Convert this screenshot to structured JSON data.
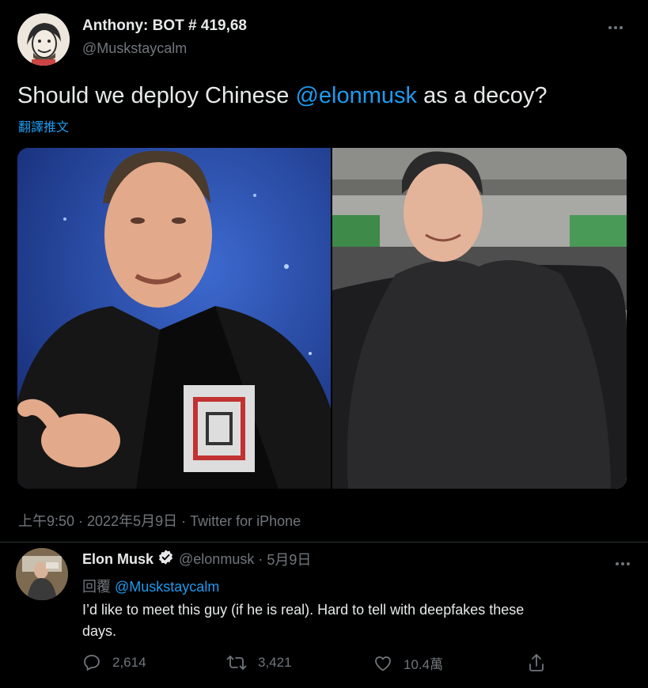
{
  "main_tweet": {
    "author_name": "Anthony: BOT # 419,68",
    "author_handle": "@Muskstaycalm",
    "more_icon": "more-horizontal-icon",
    "text_before": "Should we deploy Chinese ",
    "mention": "@elonmusk",
    "text_after": " as a decoy?",
    "translate_label": "翻譯推文",
    "images": [
      "elon-musk-photo",
      "chinese-elon-lookalike-photo"
    ],
    "timestamp": "上午9:50 · 2022年5月9日",
    "source": "Twitter for iPhone"
  },
  "reply": {
    "author_name": "Elon Musk",
    "verified_icon": "verified-badge-icon",
    "author_handle": "@elonmusk",
    "date": "5月9日",
    "more_icon": "more-horizontal-icon",
    "replying_prefix": "回覆",
    "replying_to": "@Muskstaycalm",
    "text_line1": "I’d like to meet this guy (if he is real). Hard to tell with deepfakes these",
    "text_line2": "days.",
    "actions": {
      "reply_count": "2,614",
      "retweet_count": "3,421",
      "like_count": "10.4萬"
    }
  },
  "colors": {
    "background": "#000000",
    "text": "#e7e9ea",
    "muted": "#71767b",
    "link": "#1d9bf0"
  }
}
